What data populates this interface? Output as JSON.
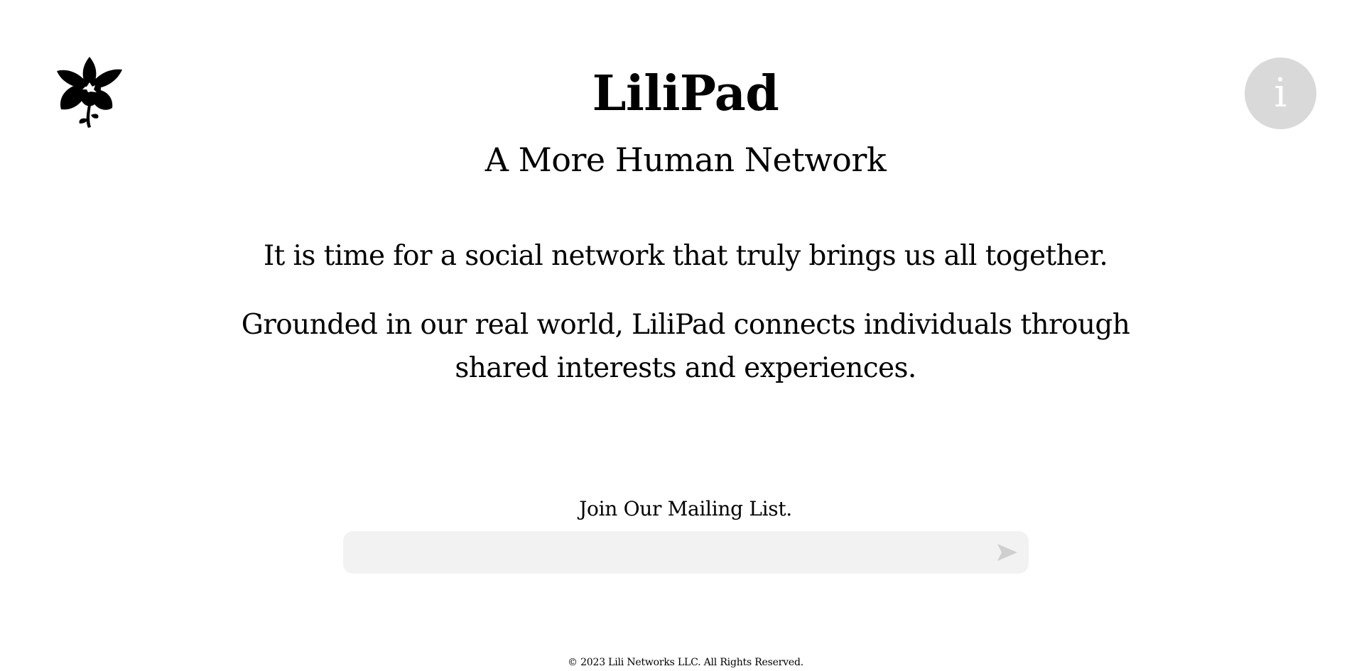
{
  "logo": {
    "icon": "orchid-flower-icon",
    "color": "#000000"
  },
  "info_button": {
    "label": "i",
    "icon": "info-icon",
    "background": "#d9d9d9"
  },
  "header": {
    "title": "LiliPad",
    "subtitle": "A More Human Network"
  },
  "main": {
    "lead": "It is time for a social network that truly brings us all together.",
    "body": "Grounded in our real world, LiliPad connects individuals through shared interests and experiences."
  },
  "mailing_list": {
    "label": "Join Our Mailing List.",
    "email_value": "",
    "email_placeholder": "",
    "submit_icon": "send-arrow-icon",
    "field_background": "#f2f2f2"
  },
  "footer": {
    "copyright": "© 2023 Lili Networks LLC. All Rights Reserved."
  }
}
